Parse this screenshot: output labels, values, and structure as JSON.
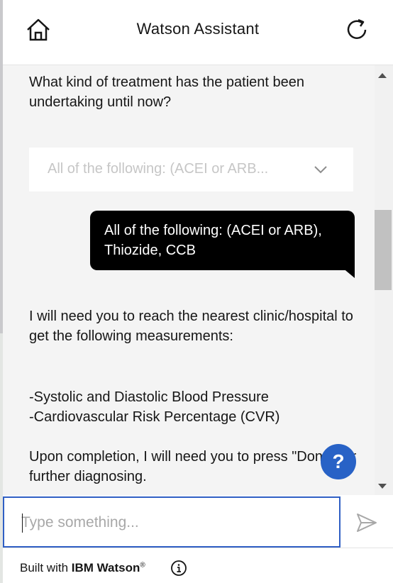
{
  "header": {
    "title": "Watson Assistant",
    "home_icon": "home-icon",
    "refresh_icon": "refresh-icon"
  },
  "chat": {
    "question": "What kind of treatment has the patient been undertaking until now?",
    "dropdown_value": "All of the following: (ACEI or ARB...",
    "user_reply": "All of the following: (ACEI or ARB), Thiozide, CCB",
    "message_1": "I will need you to reach the nearest clinic/hospital to get the following measurements:",
    "message_2": "-Systolic and Diastolic Blood Pressure\n-Cardiovascular Risk Percentage (CVR)",
    "message_3": "Upon completion, I will need you to press \"Done\" for further diagnosing."
  },
  "help_button": {
    "label": "?"
  },
  "input": {
    "placeholder": "Type something...",
    "value": ""
  },
  "footer": {
    "built_with": "Built with ",
    "brand": "IBM Watson",
    "trademark": "®"
  },
  "colors": {
    "accent": "#2f5fc4",
    "help": "#2862c6",
    "user_bubble": "#000000",
    "chat_bg": "#f4f4f4"
  }
}
